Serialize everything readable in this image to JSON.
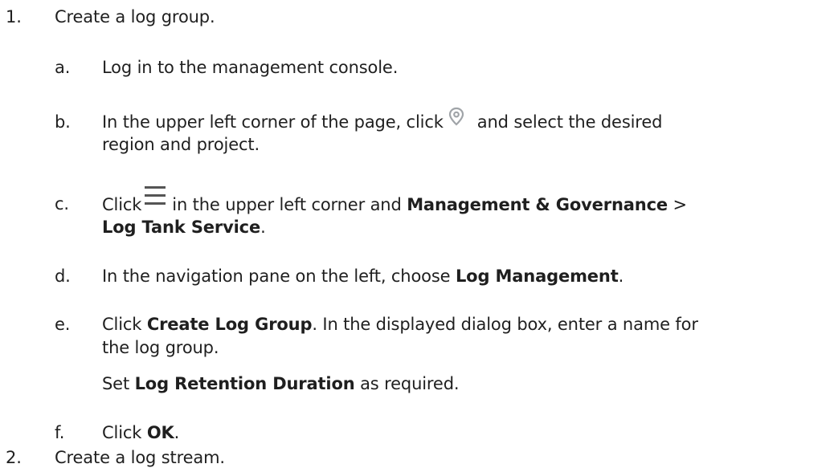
{
  "steps": [
    {
      "number": "1.",
      "text": "Create a log group.",
      "substeps": {
        "a": {
          "letter": "a.",
          "text": "Log in to the management console."
        },
        "b": {
          "letter": "b.",
          "text_1": "In the upper left corner of the page, click",
          "icon": "location-pin-icon",
          "text_2": "and select the desired",
          "text_3": "region and project."
        },
        "c": {
          "letter": "c.",
          "text_1": "Click",
          "icon": "hamburger-menu-icon",
          "text_2": "in the upper left corner and",
          "bold_1": "Management & Governance",
          "text_3": ">",
          "bold_2": "Log Tank Service",
          "text_4": "."
        },
        "d": {
          "letter": "d.",
          "text_1": "In the navigation pane on the left, choose",
          "bold_1": "Log Management",
          "text_2": "."
        },
        "e": {
          "letter": "e.",
          "text_1": "Click",
          "bold_1": "Create Log Group",
          "text_2": ". In the displayed dialog box, enter a name for",
          "text_3": "the log group.",
          "note_1": "Set",
          "note_bold": "Log Retention Duration",
          "note_2": "as required."
        },
        "f": {
          "letter": "f.",
          "text_1": "Click",
          "bold_1": "OK",
          "text_2": "."
        }
      }
    },
    {
      "number": "2.",
      "text": "Create a log stream."
    }
  ],
  "colors": {
    "text": "#1f1f1f",
    "icon": "#555555",
    "pin_icon": "#a0a4a8"
  }
}
